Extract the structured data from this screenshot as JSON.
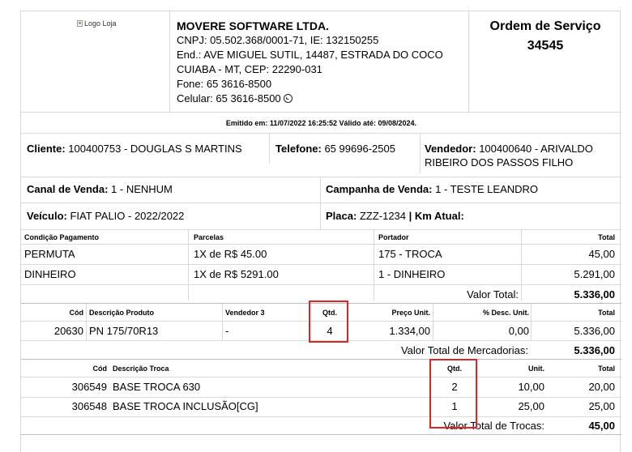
{
  "header": {
    "logo_alt": "Logo Loja",
    "company_name": "MOVERE SOFTWARE LTDA.",
    "cnpj": "CNPJ: 05.502.368/0001-71, IE: 132150255",
    "address": "End.: AVE MIGUEL SUTIL, 14487, ESTRADA DO COCO",
    "city": "CUIABA - MT, CEP: 22290-031",
    "phone": "Fone: 65 3616-8500",
    "mobile": "Celular: 65 3616-8500",
    "order_title": "Ordem de Serviço",
    "order_number": "34545"
  },
  "emitted": "Emitido em: 11/07/2022 16:25:52 Válido até: 09/08/2024.",
  "info": {
    "client_label": "Cliente:",
    "client_value": "100400753 - DOUGLAS S MARTINS",
    "phone_label": "Telefone:",
    "phone_value": "65 99696-2505",
    "seller_label": "Vendedor:",
    "seller_value_1": "100400640 - ARIVALDO",
    "seller_value_2": "RIBEIRO DOS PASSOS FILHO",
    "channel_label": "Canal de Venda:",
    "channel_value": "1 - NENHUM",
    "campaign_label": "Campanha de Venda:",
    "campaign_value": "1 - TESTE LEANDRO",
    "vehicle_label": "Veículo:",
    "vehicle_value": "FIAT PALIO - 2022/2022",
    "plate_label": "Placa:",
    "plate_value": "ZZZ-1234",
    "km_label": "| Km Atual:"
  },
  "payments": {
    "headers": [
      "Condição Pagamento",
      "Parcelas",
      "Portador",
      "Total"
    ],
    "rows": [
      [
        "PERMUTA",
        "1X de R$ 45.00",
        "175 - TROCA",
        "45,00"
      ],
      [
        "DINHEIRO",
        "1X de R$ 5291.00",
        "1 - DINHEIRO",
        "5.291,00"
      ]
    ],
    "total_label": "Valor Total:",
    "total_value": "5.336,00"
  },
  "products": {
    "headers": [
      "Cód",
      "Descrição Produto",
      "Vendedor 3",
      "Qtd.",
      "Preço Unit.",
      "% Desc. Unit.",
      "Total"
    ],
    "rows": [
      [
        "20630",
        "PN 175/70R13",
        "-",
        "4",
        "1.334,00",
        "0,00",
        "5.336,00"
      ]
    ],
    "total_label": "Valor Total de Mercadorias:",
    "total_value": "5.336,00"
  },
  "trades": {
    "headers": [
      "Cód",
      "Descrição Troca",
      "Qtd.",
      "Unit.",
      "Total"
    ],
    "rows": [
      [
        "306549",
        "BASE TROCA 630",
        "2",
        "10,00",
        "20,00"
      ],
      [
        "306548",
        "BASE TROCA INCLUSÃO[CG]",
        "1",
        "25,00",
        "25,00"
      ]
    ],
    "total_label": "Valor Total de Trocas:",
    "total_value": "45,00"
  }
}
